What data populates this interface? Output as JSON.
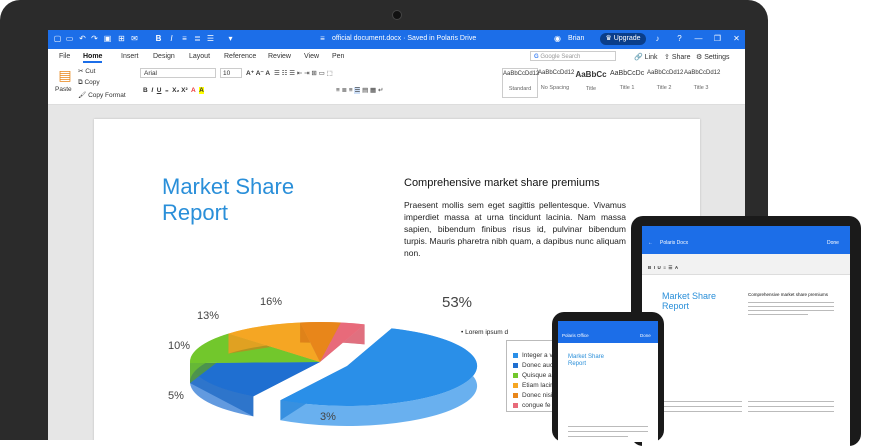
{
  "titlebar": {
    "doc_name": "official document.docx",
    "save_status": "Saved in Polaris Drive",
    "user_name": "Brian",
    "upgrade_label": "Upgrade",
    "help_label": "?"
  },
  "menu": {
    "tabs": [
      "File",
      "Home",
      "Insert",
      "Design",
      "Layout",
      "Reference",
      "Review",
      "View",
      "Pen"
    ],
    "active_tab": "Home",
    "search_placeholder": "Google Search",
    "link_label": "Link",
    "share_label": "Share",
    "settings_label": "Settings"
  },
  "ribbon": {
    "paste_label": "Paste",
    "cut_label": "Cut",
    "copy_label": "Copy",
    "copy_format_label": "Copy Format",
    "font_name": "Arial",
    "font_size": "10",
    "styles": [
      {
        "preview": "AaBbCcDd12",
        "name": "Standard"
      },
      {
        "preview": "AaBbCcDd12",
        "name": "No Spacing"
      },
      {
        "preview": "AaBbCc",
        "name": "Title"
      },
      {
        "preview": "AaBbCcDc",
        "name": "Title 1"
      },
      {
        "preview": "AaBbCcDd12",
        "name": "Title 2"
      },
      {
        "preview": "AaBbCcDd12",
        "name": "Title 3"
      }
    ]
  },
  "document": {
    "title_line1": "Market Share",
    "title_line2": "Report",
    "heading": "Comprehensive market share premiums",
    "body": "Praesent mollis sem eget sagittis pellentesque. Vivamus imperdiet massa at urna tincidunt lacinia. Nam massa sapien, bibendum finibus risus id, pulvinar bibendum turpis. Mauris pharetra nibh quam, a dapibus nunc aliquam non.",
    "legend_title": "Lorem ipsum d",
    "legend_items": [
      {
        "label": "Integer a v",
        "color": "#2a8fe8"
      },
      {
        "label": "Donec auc",
        "color": "#1f6fd1"
      },
      {
        "label": "Quisque al",
        "color": "#72c72c"
      },
      {
        "label": "Etiam lacin",
        "color": "#f5a623"
      },
      {
        "label": "Donec nisi",
        "color": "#e8861a"
      },
      {
        "label": "congue fe",
        "color": "#e86a7a"
      }
    ]
  },
  "chart_data": {
    "type": "pie",
    "categories": [
      "53%",
      "16%",
      "13%",
      "10%",
      "5%",
      "3%"
    ],
    "values": [
      53,
      16,
      13,
      10,
      5,
      3
    ],
    "labels": [
      "53%",
      "16%",
      "13%",
      "10%",
      "5%",
      "3%"
    ],
    "colors": [
      "#2a8fe8",
      "#1f6fd1",
      "#72c72c",
      "#f5a623",
      "#e8861a",
      "#e86a7a"
    ]
  },
  "tablet": {
    "doc_name": "Polaris Docx",
    "title": "Market Share Report",
    "heading": "Comprehensive market share premiums"
  },
  "phone": {
    "app_name": "Polaris Office",
    "done_label": "Done",
    "title": "Market Share Report"
  }
}
